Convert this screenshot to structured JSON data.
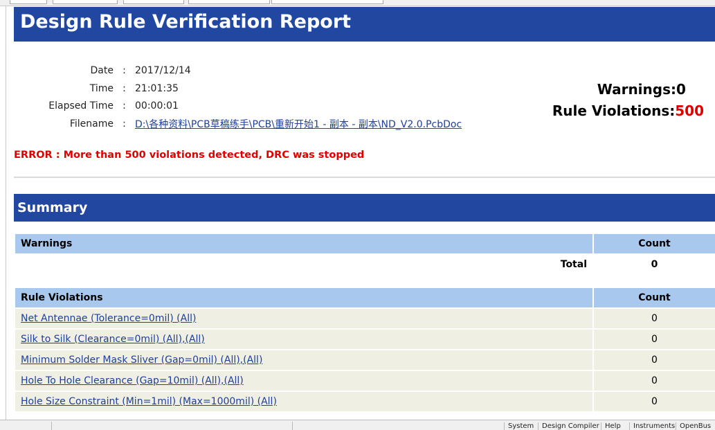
{
  "report": {
    "title": "Design Rule Verification Report",
    "meta": [
      {
        "label": "Date",
        "value": "2017/12/14"
      },
      {
        "label": "Time",
        "value": "21:01:35"
      },
      {
        "label": "Elapsed Time",
        "value": "00:00:01"
      },
      {
        "label": "Filename",
        "value": "D:\\各种资料\\PCB草稿练手\\PCB\\重新开始1 - 副本 - 副本\\ND_V2.0.PcbDoc"
      }
    ],
    "stats": {
      "warnings_label": "Warnings",
      "warnings_value": "0",
      "violations_label": "Rule Violations",
      "violations_value": "500"
    },
    "error": "ERROR : More than 500 violations detected, DRC was stopped",
    "summary_title": "Summary",
    "warnings_table": {
      "header": "Warnings",
      "count_header": "Count",
      "total_label": "Total",
      "total_value": "0"
    },
    "violations_table": {
      "header": "Rule Violations",
      "count_header": "Count",
      "rows": [
        {
          "rule": "Net Antennae (Tolerance=0mil) (All)",
          "count": "0"
        },
        {
          "rule": "Silk to Silk (Clearance=0mil) (All),(All)",
          "count": "0"
        },
        {
          "rule": "Minimum Solder Mask Sliver (Gap=0mil) (All),(All)",
          "count": "0"
        },
        {
          "rule": "Hole To Hole Clearance (Gap=10mil) (All),(All)",
          "count": "0"
        },
        {
          "rule": "Hole Size Constraint (Min=1mil) (Max=1000mil) (All)",
          "count": "0"
        }
      ]
    }
  },
  "status_bar": {
    "items": [
      "System",
      "Design Compiler",
      "Help",
      "Instruments",
      "OpenBus"
    ]
  },
  "colors": {
    "header_blue": "#2247a0",
    "table_header": "#a8c8ee",
    "row_bg": "#efefe4",
    "error_red": "#e00000",
    "link_blue": "#1f3f99"
  }
}
